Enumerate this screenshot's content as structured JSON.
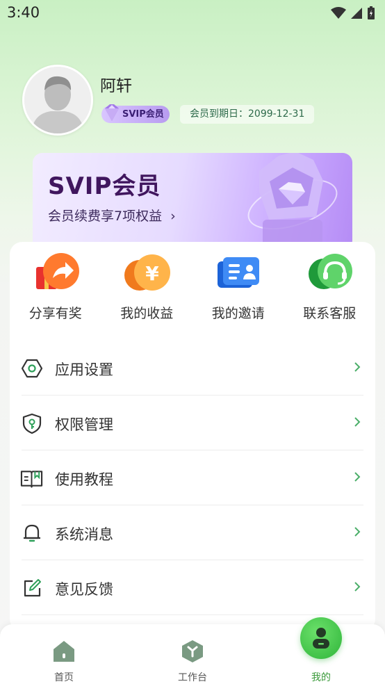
{
  "status_bar": {
    "time": "3:40"
  },
  "profile": {
    "name": "阿轩",
    "badge": "SVIP会员",
    "expire": "会员到期日：2099-12-31"
  },
  "vip_card": {
    "title": "SVIP会员",
    "subtitle": "会员续费享7项权益",
    "arrow": "›"
  },
  "quick_actions": [
    {
      "label": "分享有奖",
      "icon": "gift-share-icon"
    },
    {
      "label": "我的收益",
      "icon": "yuan-coin-icon"
    },
    {
      "label": "我的邀请",
      "icon": "contact-card-icon"
    },
    {
      "label": "联系客服",
      "icon": "headset-icon"
    }
  ],
  "menu": [
    {
      "label": "应用设置",
      "icon": "hexagon-settings-icon",
      "arrow": "›"
    },
    {
      "label": "权限管理",
      "icon": "shield-key-icon",
      "arrow": "›"
    },
    {
      "label": "使用教程",
      "icon": "book-icon",
      "arrow": "›"
    },
    {
      "label": "系统消息",
      "icon": "bell-icon",
      "arrow": "›"
    },
    {
      "label": "意见反馈",
      "icon": "edit-feedback-icon",
      "arrow": "›"
    }
  ],
  "bottom_nav": [
    {
      "label": "首页",
      "icon": "home-icon"
    },
    {
      "label": "工作台",
      "icon": "workbench-icon"
    },
    {
      "label": "我的",
      "icon": "user-icon",
      "active": true
    }
  ],
  "colors": {
    "accent_green": "#3a9a3a",
    "svip_purple": "#40165e",
    "arrow_green": "#4caf6a"
  }
}
